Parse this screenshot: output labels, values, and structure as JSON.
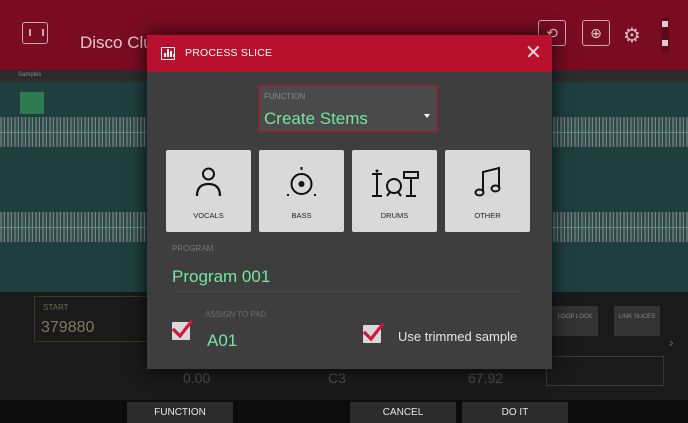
{
  "background": {
    "sample_small_label": "",
    "sample_name": "Disco Clu",
    "tabs": [
      "Samples"
    ],
    "start_label": "START",
    "start_value": "379880",
    "buttons": [
      "LOOP LOCK",
      "LINK SLICES"
    ],
    "bottom_values": [
      "0.00",
      "C3",
      "67.92"
    ]
  },
  "dialog": {
    "title": "PROCESS SLICE",
    "function_label": "FUNCTION",
    "function_value": "Create Stems",
    "stems": [
      {
        "label": "VOCALS",
        "icon": "person-icon"
      },
      {
        "label": "BASS",
        "icon": "speaker-icon"
      },
      {
        "label": "DRUMS",
        "icon": "drum-kit-icon"
      },
      {
        "label": "OTHER",
        "icon": "music-note-icon"
      }
    ],
    "program_label": "PROGRAM",
    "program_value": "Program 001",
    "assign_label": "ASSIGN TO PAD",
    "assign_value": "A01",
    "assign_checked": true,
    "trim_label": "Use trimmed sample",
    "trim_checked": true
  },
  "footer": {
    "function_btn": "FUNCTION",
    "cancel_btn": "CANCEL",
    "doit_btn": "DO IT"
  },
  "colors": {
    "accent": "#b8102d",
    "value_green": "#77e3a4",
    "dialog_bg": "#3e3e3e"
  }
}
